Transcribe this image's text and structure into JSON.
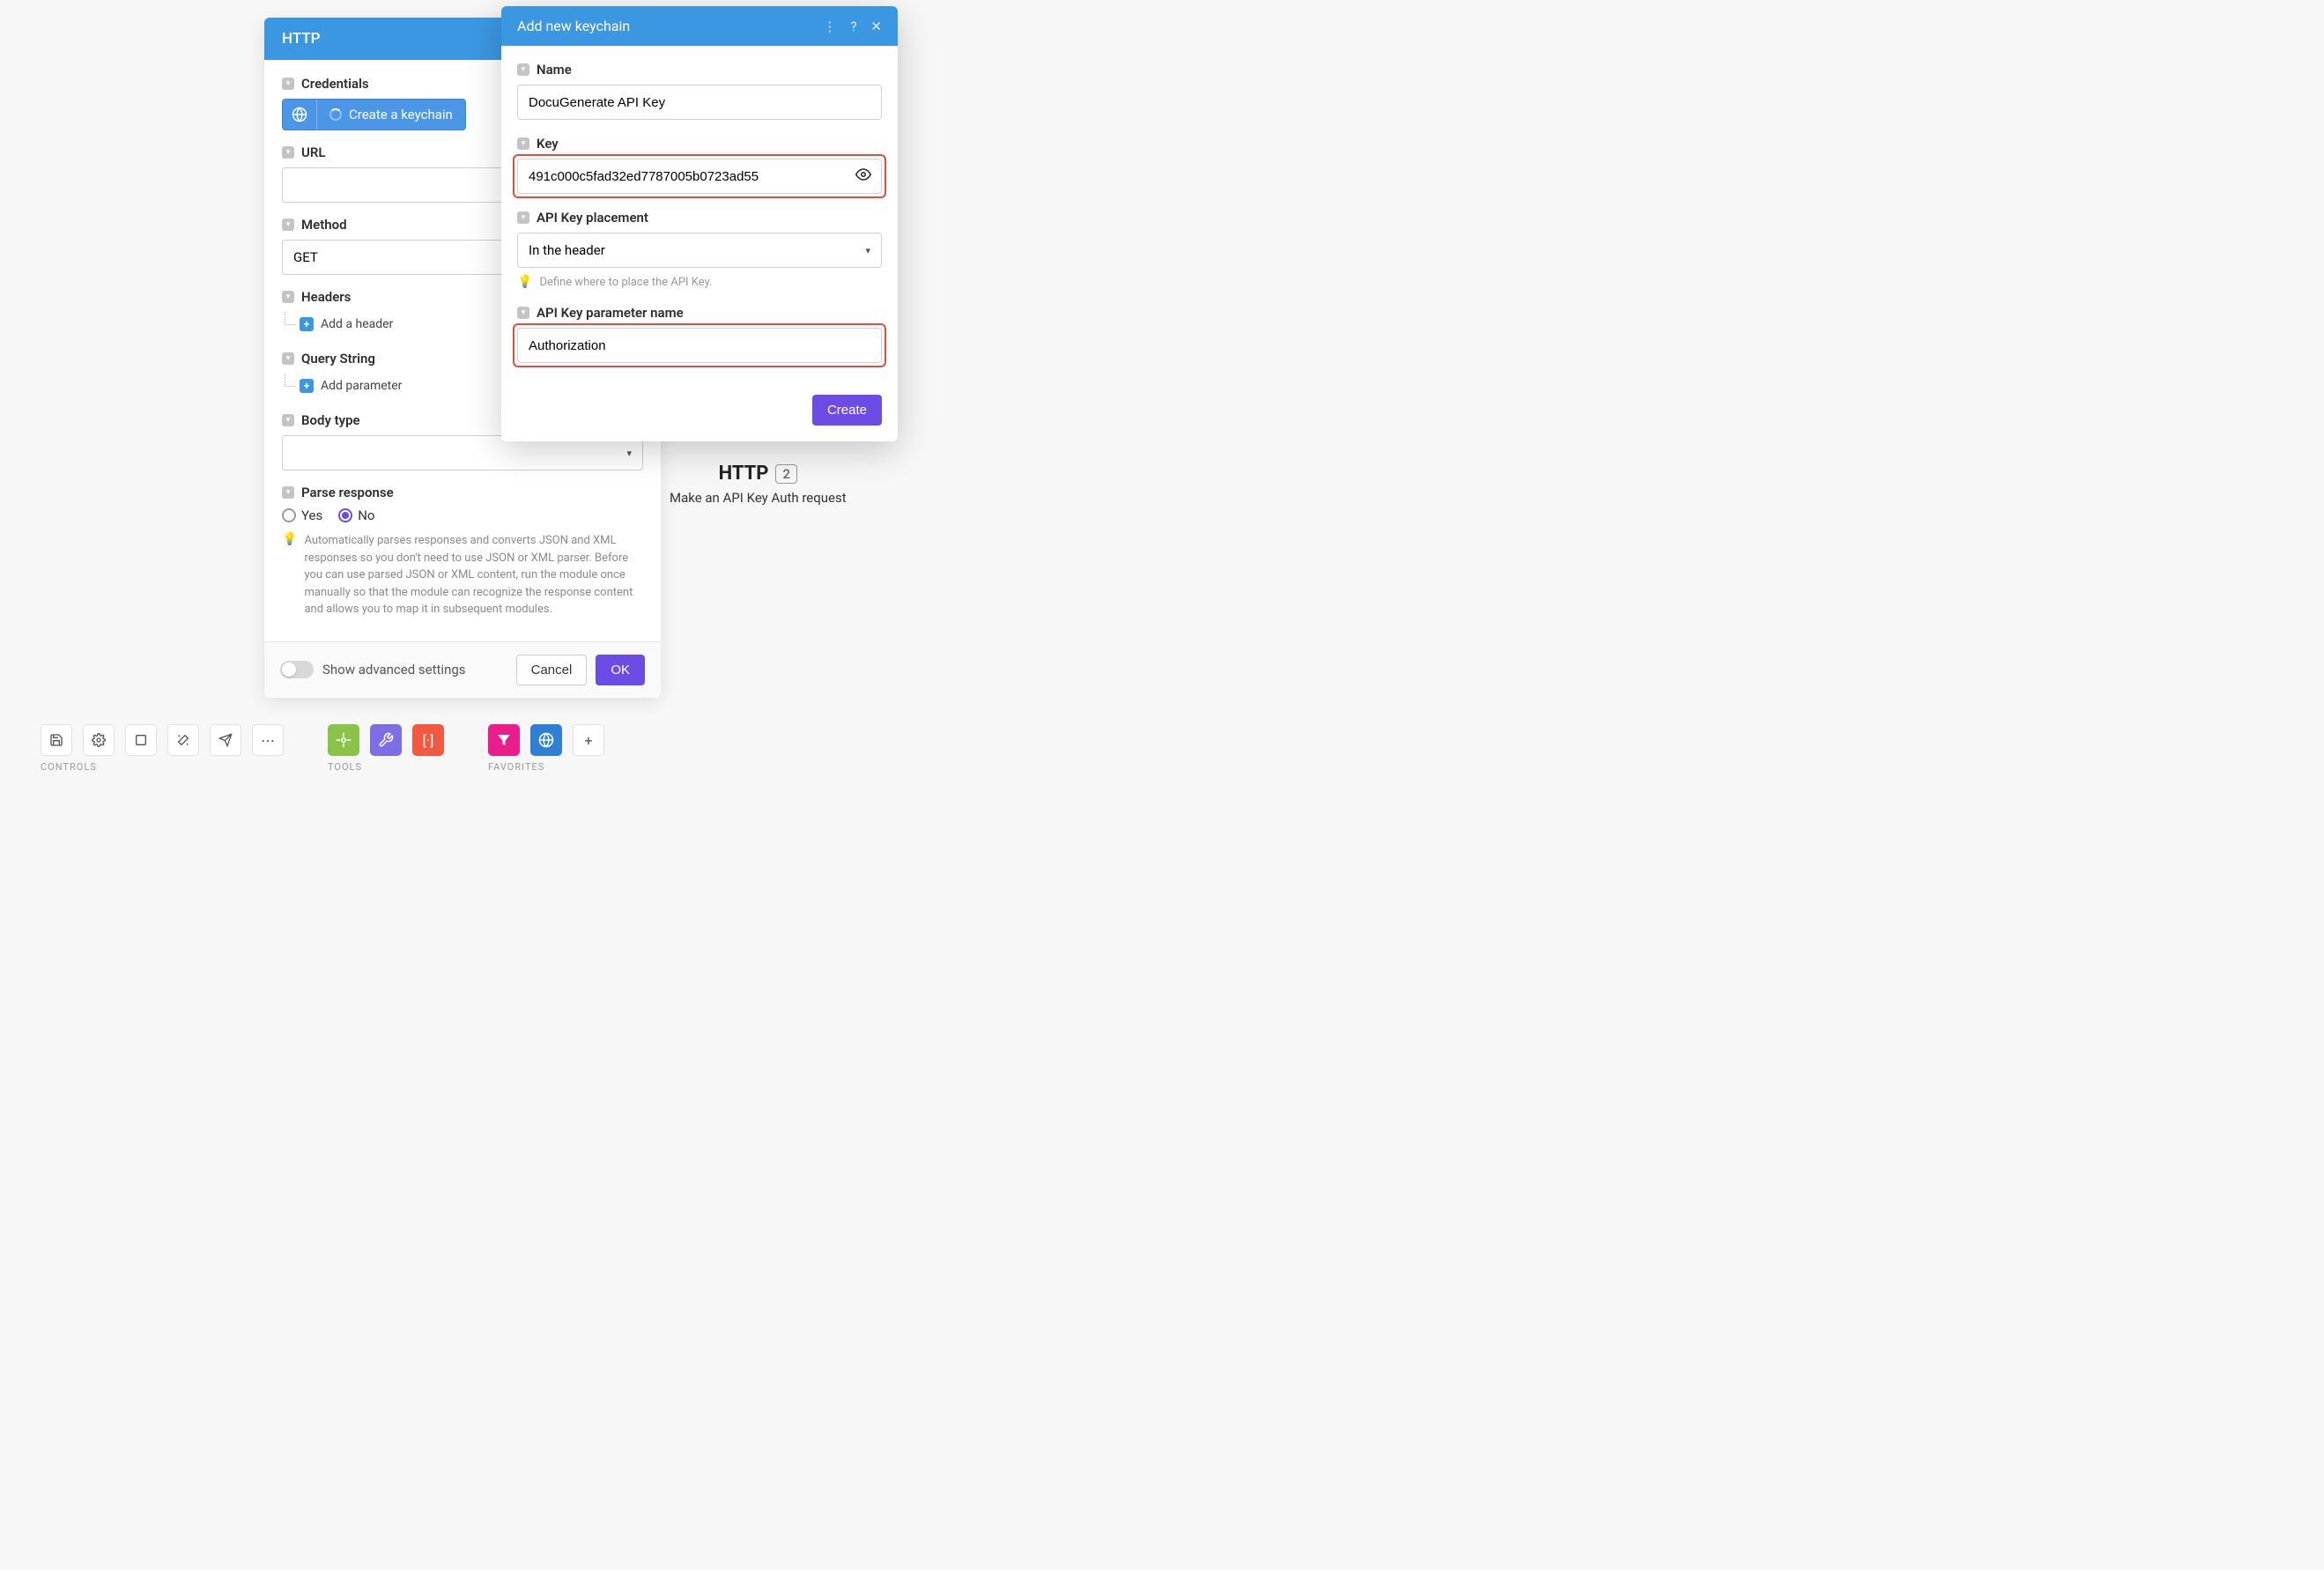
{
  "httpPanel": {
    "title": "HTTP",
    "credentials": {
      "label": "Credentials",
      "button": "Create a keychain"
    },
    "url": {
      "label": "URL",
      "value": ""
    },
    "method": {
      "label": "Method",
      "value": "GET"
    },
    "headers": {
      "label": "Headers",
      "add": "Add a header"
    },
    "query": {
      "label": "Query String",
      "add": "Add parameter"
    },
    "bodyType": {
      "label": "Body type",
      "value": ""
    },
    "parseResponse": {
      "label": "Parse response",
      "yes": "Yes",
      "no": "No",
      "selected": "No",
      "hint": "Automatically parses responses and converts JSON and XML responses so you don't need to use JSON or XML parser. Before you can use parsed JSON or XML content, run the module once manually so that the module can recognize the response content and allows you to map it in subsequent modules."
    },
    "footer": {
      "advanced": "Show advanced settings",
      "cancel": "Cancel",
      "ok": "OK"
    }
  },
  "keychainModal": {
    "title": "Add new keychain",
    "name": {
      "label": "Name",
      "value": "DocuGenerate API Key"
    },
    "key": {
      "label": "Key",
      "value": "491c000c5fad32ed7787005b0723ad55"
    },
    "placement": {
      "label": "API Key placement",
      "value": "In the header",
      "hint": "Define where to place the API Key."
    },
    "paramName": {
      "label": "API Key parameter name",
      "value": "Authorization"
    },
    "create": "Create"
  },
  "canvasNode": {
    "title": "HTTP",
    "badge": "2",
    "subtitle": "Make an API Key Auth request"
  },
  "toolbar": {
    "controls": "CONTROLS",
    "tools": "TOOLS",
    "favorites": "FAVORITES"
  }
}
